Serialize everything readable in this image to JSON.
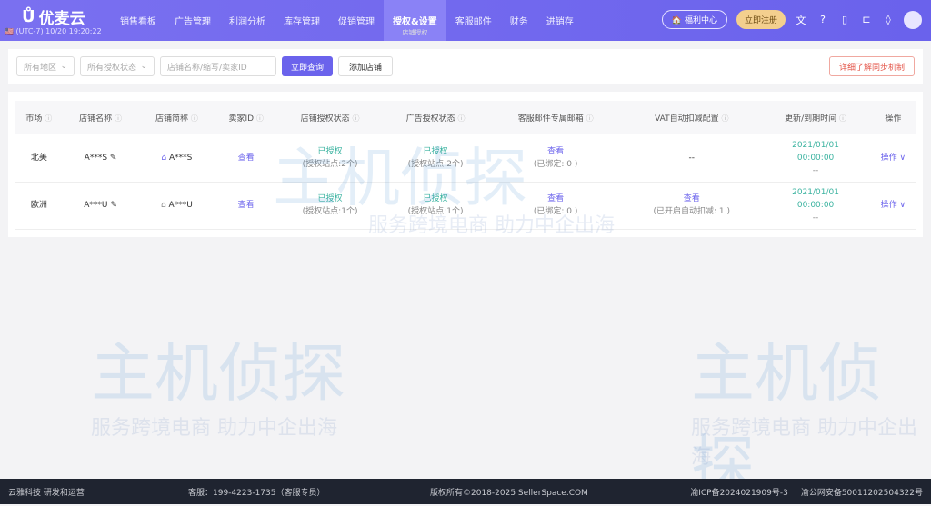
{
  "header": {
    "brand": "优麦云",
    "timezone": "(UTC-7)  10/20 19:20:22",
    "nav": [
      "销售看板",
      "广告管理",
      "利润分析",
      "库存管理",
      "促销管理",
      "授权&设置",
      "客服邮件",
      "财务",
      "进销存"
    ],
    "active_sub": "店铺授权",
    "welfare": "福利中心",
    "register": "立即注册"
  },
  "filters": {
    "region": "所有地区",
    "auth_status": "所有授权状态",
    "search_placeholder": "店铺名称/缩写/卖家ID",
    "query": "立即查询",
    "add": "添加店铺",
    "learn": "详细了解同步机制"
  },
  "table": {
    "headers": [
      "市场",
      "店铺名称",
      "店铺简称",
      "卖家ID",
      "店铺授权状态",
      "广告授权状态",
      "客服邮件专属邮箱",
      "VAT自动扣减配置",
      "更新/到期时间",
      "操作"
    ],
    "rows": [
      {
        "market": "北美",
        "name": "A***S",
        "short": "A***S",
        "seller": "查看",
        "shop_auth": "已授权",
        "shop_sites": "(授权站点:2个)",
        "ad_auth": "已授权",
        "ad_sites": "(授权站点:2个)",
        "mail": "查看",
        "mail_sub": "(已绑定: 0 )",
        "vat": "--",
        "vat_sub": "",
        "date": "2021/01/01",
        "time": "00:00:00",
        "extra": "--",
        "op": "操作"
      },
      {
        "market": "欧洲",
        "name": "A***U",
        "short": "A***U",
        "seller": "查看",
        "shop_auth": "已授权",
        "shop_sites": "(授权站点:1个)",
        "ad_auth": "已授权",
        "ad_sites": "(授权站点:1个)",
        "mail": "查看",
        "mail_sub": "(已绑定: 0 )",
        "vat": "查看",
        "vat_sub": "(已开启自动扣减: 1 )",
        "date": "2021/01/01",
        "time": "00:00:00",
        "extra": "--",
        "op": "操作"
      }
    ]
  },
  "watermark": {
    "line1": "主机侦探",
    "line2": "服务跨境电商 助力中企出海"
  },
  "footer": {
    "company": "云雅科技 研发和运营",
    "phone": "客服：199-4223-1735（客服专员）",
    "copyright": "版权所有©2018-2025 SellerSpace.COM",
    "icp": "渝ICP备2024021909号-3",
    "police": "渝公网安备50011202504322号"
  }
}
